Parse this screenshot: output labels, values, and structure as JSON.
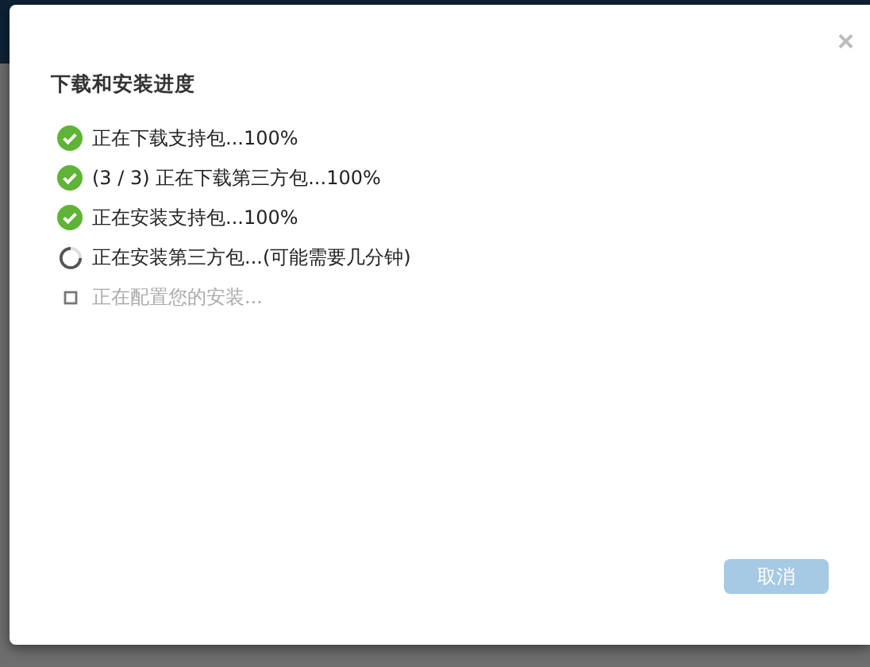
{
  "dialog": {
    "title": "下载和安装进度",
    "close": "×",
    "steps": [
      {
        "kind": "done",
        "text": "正在下载支持包...100%"
      },
      {
        "kind": "done",
        "text": "(3 / 3) 正在下载第三方包...100%"
      },
      {
        "kind": "done",
        "text": "正在安装支持包...100%"
      },
      {
        "kind": "running",
        "text": "正在安装第三方包...(可能需要几分钟)"
      },
      {
        "kind": "pending",
        "text": "正在配置您的安装..."
      }
    ],
    "cancel": {
      "label": "取消",
      "disabled": true
    }
  }
}
